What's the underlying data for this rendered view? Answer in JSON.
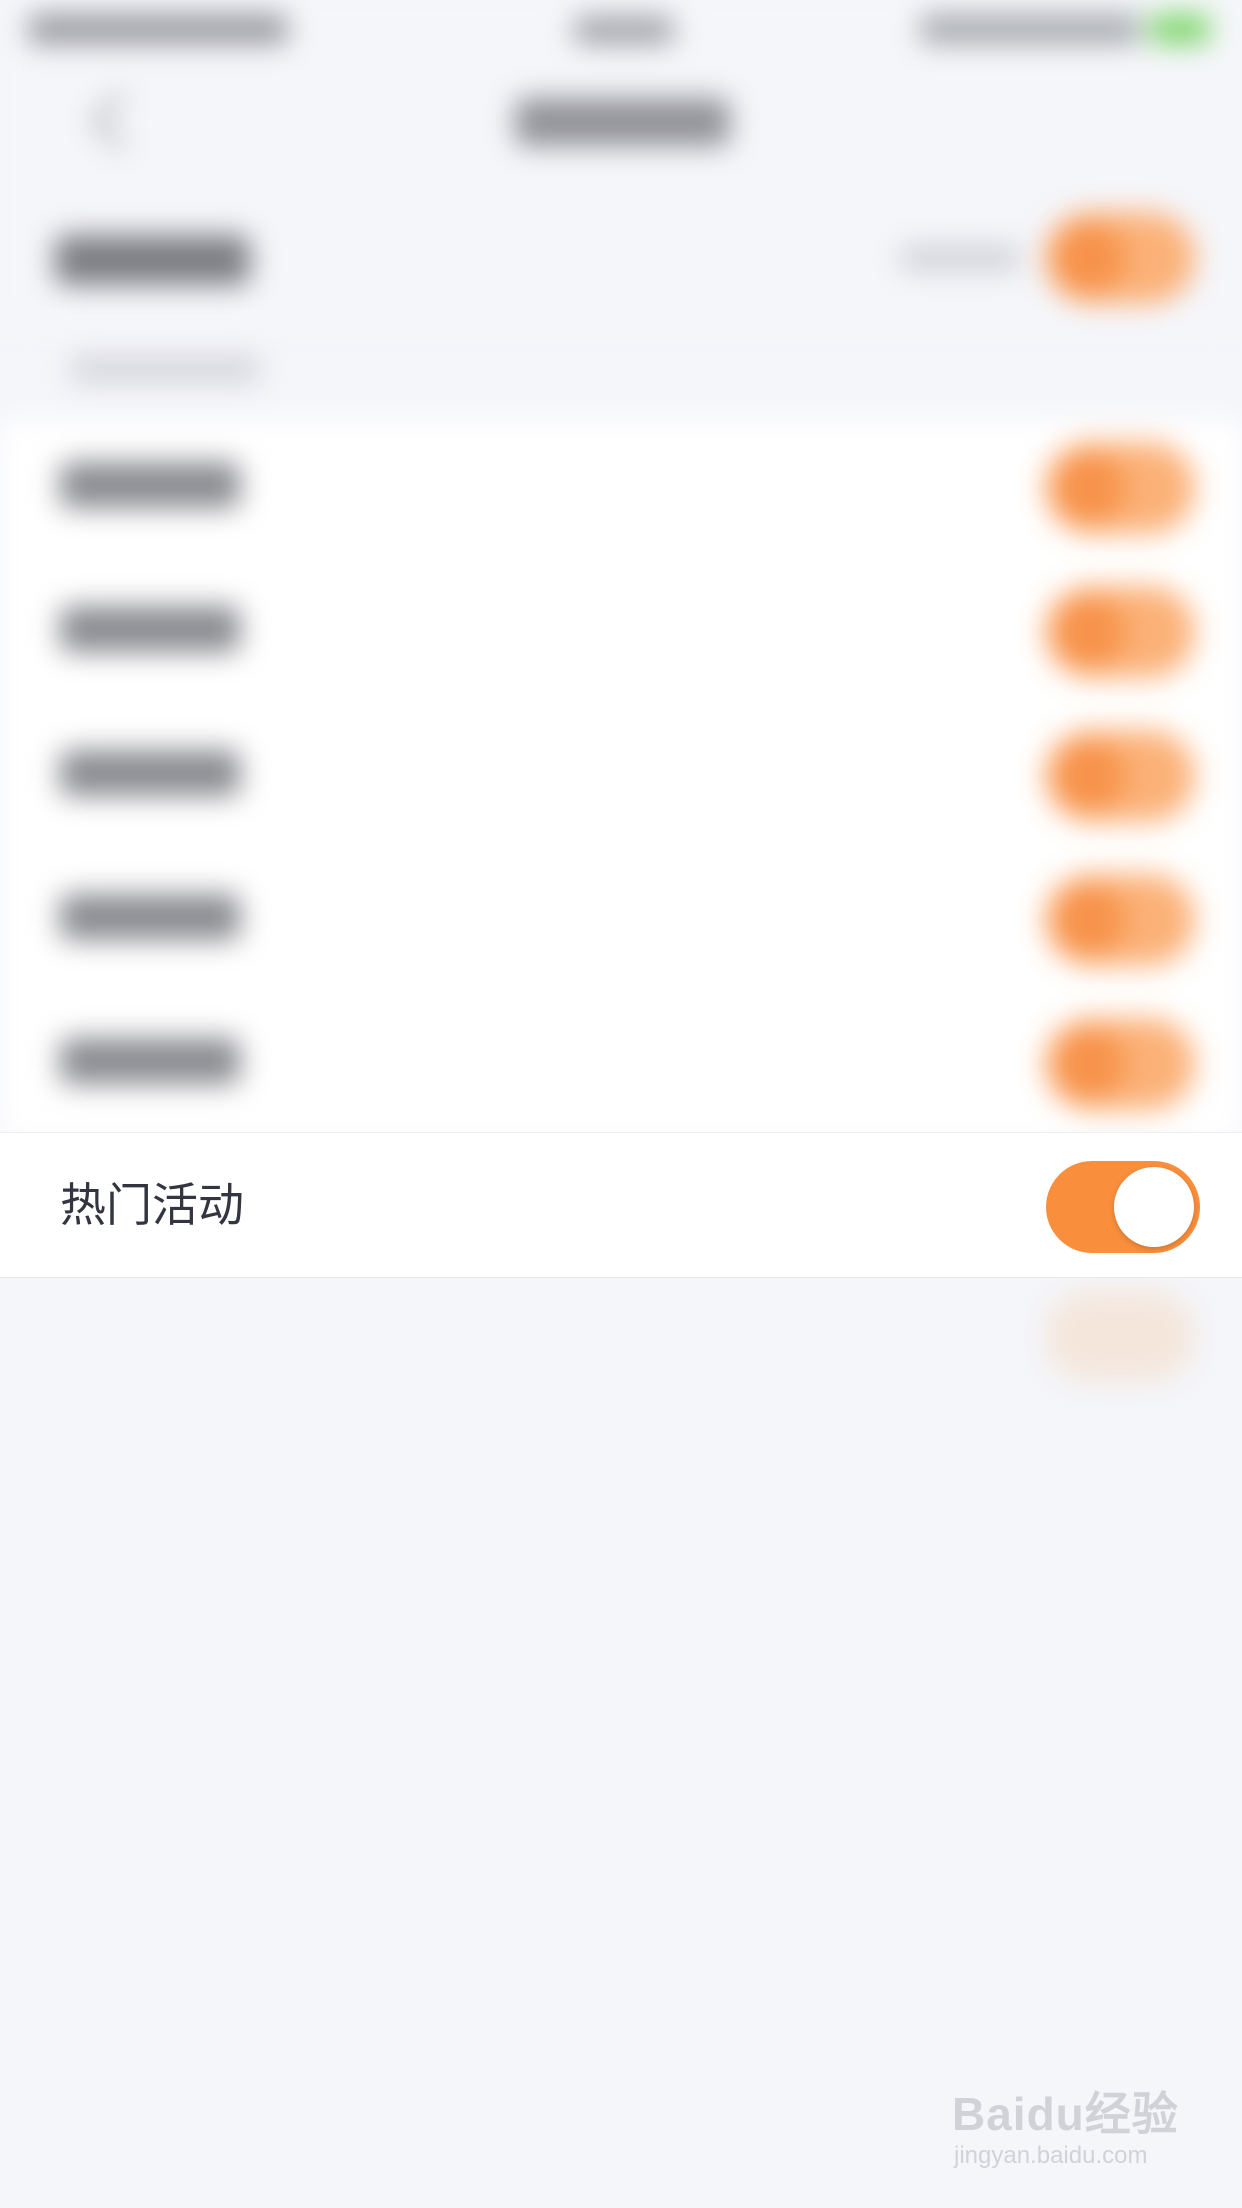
{
  "settings": {
    "focused_row": {
      "label": "热门活动",
      "toggle_on": true
    }
  },
  "colors": {
    "accent": "#f98f3c",
    "page_background": "#f5f6fa",
    "row_background": "#ffffff",
    "label_text": "#333640"
  },
  "watermark": {
    "brand": "Baidu经验",
    "url": "jingyan.baidu.com"
  }
}
